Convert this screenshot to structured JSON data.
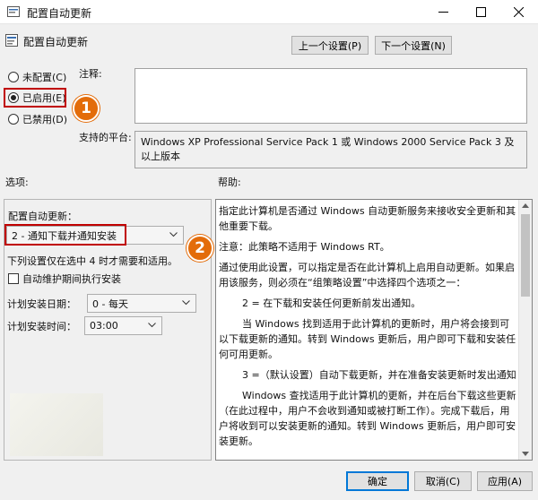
{
  "window": {
    "title": "配置自动更新"
  },
  "header": {
    "setting_name": "配置自动更新",
    "prev_label": "上一个设置(P)",
    "next_label": "下一个设置(N)"
  },
  "state": {
    "not_configured": "未配置(C)",
    "enabled": "已启用(E)",
    "disabled": "已禁用(D)"
  },
  "comment_label": "注释:",
  "platform_label": "支持的平台:",
  "platform_value": "Windows XP Professional Service Pack 1 或 Windows 2000 Service Pack 3 及以上版本",
  "options": {
    "label": "选项:",
    "configure_label": "配置自动更新：",
    "configure_value": "2 - 通知下载并通知安装",
    "note": "下列设置仅在选中 4 时才需要和适用。",
    "maintenance_label": "自动维护期间执行安装",
    "day_label": "计划安装日期：",
    "day_value": "0 - 每天",
    "time_label": "计划安装时间：",
    "time_value": "03:00"
  },
  "help": {
    "label": "帮助:",
    "p1": "指定此计算机是否通过 Windows 自动更新服务来接收安全更新和其他重要下载。",
    "p2": "注意：此策略不适用于 Windows RT。",
    "p3": "通过使用此设置，可以指定是否在此计算机上启用自动更新。如果启用该服务，则必须在“组策略设置”中选择四个选项之一：",
    "p4": "2 = 在下载和安装任何更新前发出通知。",
    "p5": "当 Windows 找到适用于此计算机的更新时，用户将会接到可以下载更新的通知。转到 Windows 更新后，用户即可下载和安装任何可用更新。",
    "p6": "3 =（默认设置）自动下载更新，并在准备安装更新时发出通知",
    "p7": "Windows 查找适用于此计算机的更新，并在后台下载这些更新（在此过程中，用户不会收到通知或被打断工作）。完成下载后，用户将收到可以安装更新的通知。转到 Windows 更新后，用户即可安装更新。"
  },
  "footer": {
    "ok": "确定",
    "cancel": "取消(C)",
    "apply": "应用(A)"
  },
  "annotations": {
    "one": "1",
    "two": "2"
  },
  "colors": {
    "badge": "#e36c0a",
    "highlight": "#c00000",
    "accent": "#0078d7"
  }
}
